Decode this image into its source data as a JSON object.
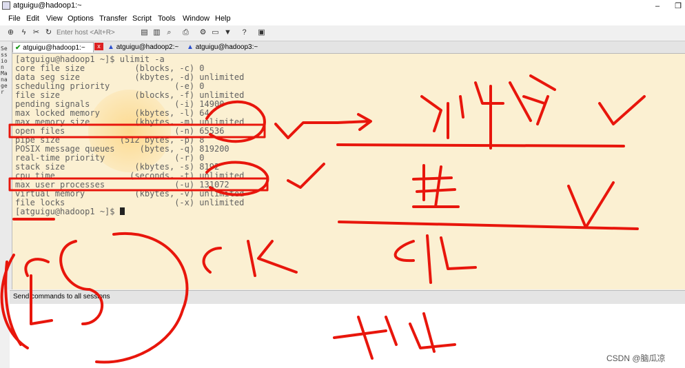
{
  "window": {
    "title": "atguigu@hadoop1:~",
    "minimize": "–",
    "restore": "❐"
  },
  "menu": [
    "File",
    "Edit",
    "View",
    "Options",
    "Transfer",
    "Script",
    "Tools",
    "Window",
    "Help"
  ],
  "toolbar": {
    "host_placeholder": "Enter host <Alt+R>"
  },
  "tabs": [
    {
      "label": "atguigu@hadoop1:~",
      "status": "connected",
      "close": "x"
    },
    {
      "label": "atguigu@hadoop2:~",
      "status": "warning"
    },
    {
      "label": "atguigu@hadoop3:~",
      "status": "warning"
    }
  ],
  "session_manager_label": "Session Manager",
  "terminal": {
    "lines": [
      "[atguigu@hadoop1 ~]$ ulimit -a",
      "core file size          (blocks, -c) 0",
      "data seg size           (kbytes, -d) unlimited",
      "scheduling priority             (-e) 0",
      "file size               (blocks, -f) unlimited",
      "pending signals                 (-i) 14900",
      "max locked memory       (kbytes, -l) 64",
      "max memory size         (kbytes, -m) unlimited",
      "open files                      (-n) 65536",
      "pipe size            (512 bytes, -p) 8",
      "POSIX message queues     (bytes, -q) 819200",
      "real-time priority              (-r) 0",
      "stack size              (kbytes, -s) 8192",
      "cpu time               (seconds, -t) unlimited",
      "max user processes              (-u) 131072",
      "virtual memory          (kbytes, -v) unlimited",
      "file locks                      (-x) unlimited",
      "[atguigu@hadoop1 ~]$ "
    ]
  },
  "send_bar": {
    "label": "Send commands to all sessions"
  },
  "watermark": "CSDN @脑瓜凉",
  "colors": {
    "terminal_bg": "#fbf0d2",
    "terminal_text": "#616161",
    "ink": "#e8160c"
  },
  "icons": [
    "connect-icon",
    "lightning-icon",
    "disconnect-icon",
    "reconnect-icon",
    "copy-icon",
    "paste-icon",
    "find-icon",
    "print-icon",
    "settings-icon",
    "keymap-icon",
    "sftp-icon",
    "help-icon",
    "session-icon"
  ]
}
